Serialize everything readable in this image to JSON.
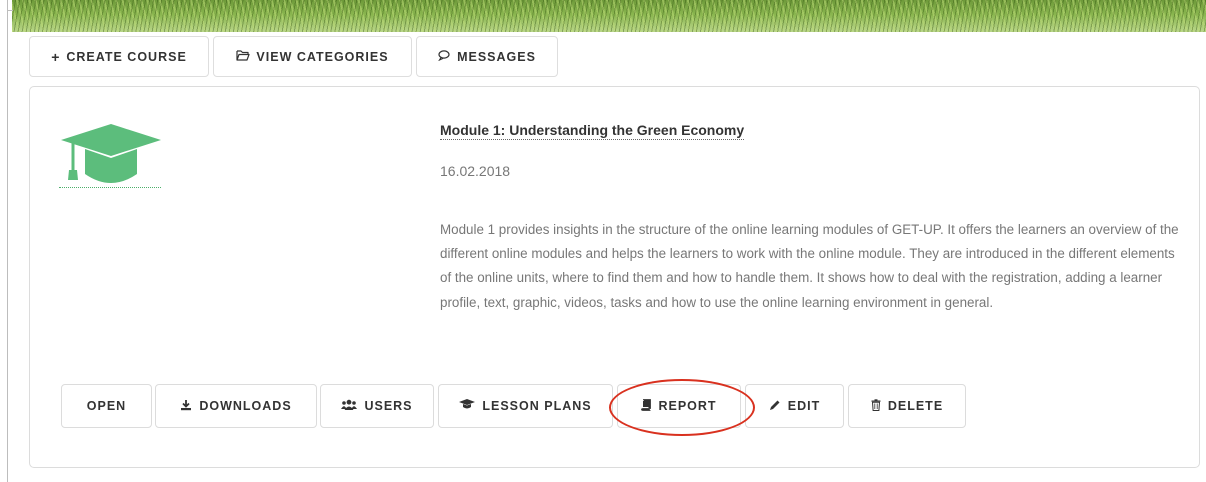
{
  "toolbar": {
    "create_course": "CREATE COURSE",
    "view_categories": "VIEW CATEGORIES",
    "messages": "MESSAGES"
  },
  "course": {
    "title": "Module 1: Understanding the Green Economy",
    "date": "16.02.2018",
    "description": "Module 1 provides insights in the structure of the online learning modules of GET-UP. It offers the learners an overview of the different online modules and helps the learners to work with the online module. They are introduced in the different elements of the online units, where to find them and how to handle them. It shows how to deal with the registration, adding a learner profile, text, graphic, videos, tasks and how to use the online learning environment in general."
  },
  "actions": {
    "open": "OPEN",
    "downloads": "DOWNLOADS",
    "users": "USERS",
    "lesson_plans": "LESSON PLANS",
    "report": "REPORT",
    "edit": "EDIT",
    "delete": "DELETE"
  },
  "colors": {
    "brand_green": "#5cbd7c",
    "highlight_red": "#d9311f"
  },
  "icons": {
    "create": "plus-icon",
    "categories": "folder-open-icon",
    "messages": "comments-icon",
    "course": "graduation-cap-icon",
    "downloads": "download-icon",
    "users": "users-icon",
    "lesson_plans": "graduation-cap-icon",
    "report": "book-icon",
    "edit": "pencil-icon",
    "delete": "trash-icon"
  }
}
